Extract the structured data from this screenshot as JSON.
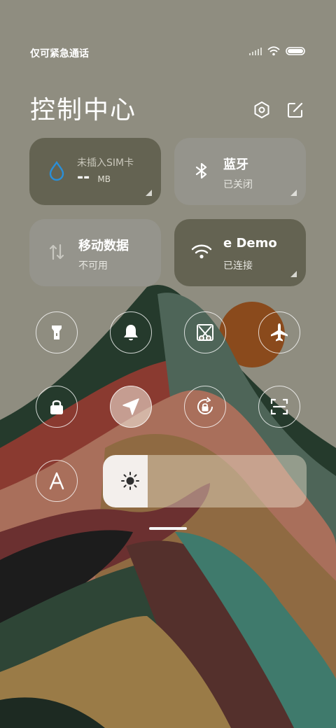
{
  "status_bar": {
    "carrier_text": "仅可紧急通话"
  },
  "header": {
    "title": "控制中心"
  },
  "tiles": {
    "data_usage": {
      "label": "未插入SIM卡",
      "value": "--",
      "unit": "MB"
    },
    "bluetooth": {
      "label": "蓝牙",
      "status": "已关闭"
    },
    "mobile_data": {
      "label": "移动数据",
      "status": "不可用"
    },
    "wifi": {
      "network": "e      Demo",
      "status": "已连接"
    }
  },
  "quick_toggles": [
    {
      "name": "flashlight-toggle",
      "icon": "flashlight-icon",
      "active": false
    },
    {
      "name": "mute-toggle",
      "icon": "bell-icon",
      "active": false
    },
    {
      "name": "screenshot-toggle",
      "icon": "scissors-icon",
      "active": false
    },
    {
      "name": "airplane-mode-toggle",
      "icon": "airplane-icon",
      "active": false
    },
    {
      "name": "lock-screen-toggle",
      "icon": "lock-icon",
      "active": false
    },
    {
      "name": "location-toggle",
      "icon": "location-arrow-icon",
      "active": true
    },
    {
      "name": "rotation-lock-toggle",
      "icon": "rotation-lock-icon",
      "active": false
    },
    {
      "name": "scan-toggle",
      "icon": "scan-icon",
      "active": false
    },
    {
      "name": "font-size-toggle",
      "icon": "font-icon",
      "active": false
    }
  ],
  "brightness": {
    "level": 0.22
  },
  "colors": {
    "accent_blue": "#2a8fd8",
    "tile_dark": "#5f5d4b",
    "tile_light": "#96958d"
  }
}
